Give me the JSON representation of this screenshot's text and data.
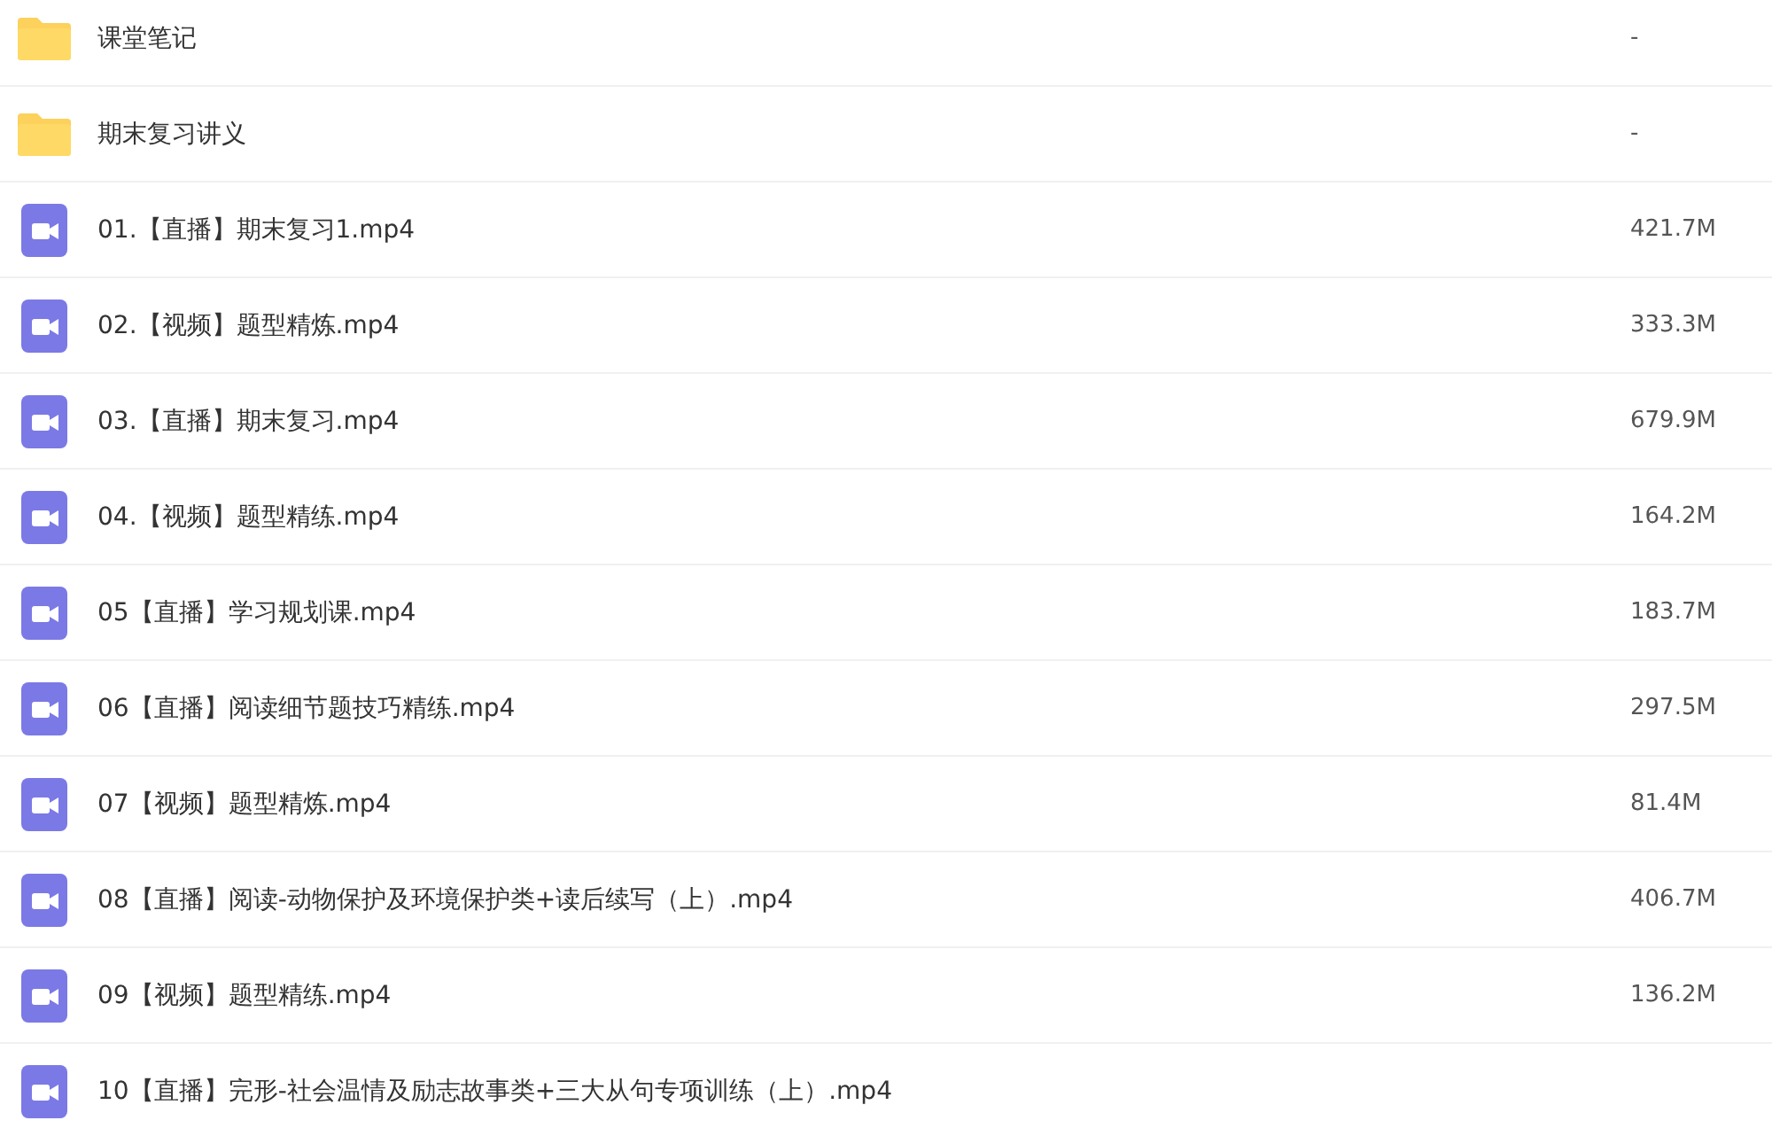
{
  "files": [
    {
      "kind": "folder",
      "name": "课堂笔记",
      "size": "-"
    },
    {
      "kind": "folder",
      "name": "期末复习讲义",
      "size": "-"
    },
    {
      "kind": "video",
      "name": "01.【直播】期末复习1.mp4",
      "size": "421.7M"
    },
    {
      "kind": "video",
      "name": "02.【视频】题型精炼.mp4",
      "size": "333.3M"
    },
    {
      "kind": "video",
      "name": "03.【直播】期末复习.mp4",
      "size": "679.9M"
    },
    {
      "kind": "video",
      "name": "04.【视频】题型精练.mp4",
      "size": "164.2M"
    },
    {
      "kind": "video",
      "name": "05【直播】学习规划课.mp4",
      "size": "183.7M"
    },
    {
      "kind": "video",
      "name": "06【直播】阅读细节题技巧精练.mp4",
      "size": "297.5M"
    },
    {
      "kind": "video",
      "name": "07【视频】题型精炼.mp4",
      "size": "81.4M"
    },
    {
      "kind": "video",
      "name": "08【直播】阅读-动物保护及环境保护类+读后续写（上）.mp4",
      "size": "406.7M"
    },
    {
      "kind": "video",
      "name": "09【视频】题型精练.mp4",
      "size": "136.2M"
    },
    {
      "kind": "video",
      "name": "10【直播】完形-社会温情及励志故事类+三大从句专项训练（上）.mp4"
    }
  ]
}
